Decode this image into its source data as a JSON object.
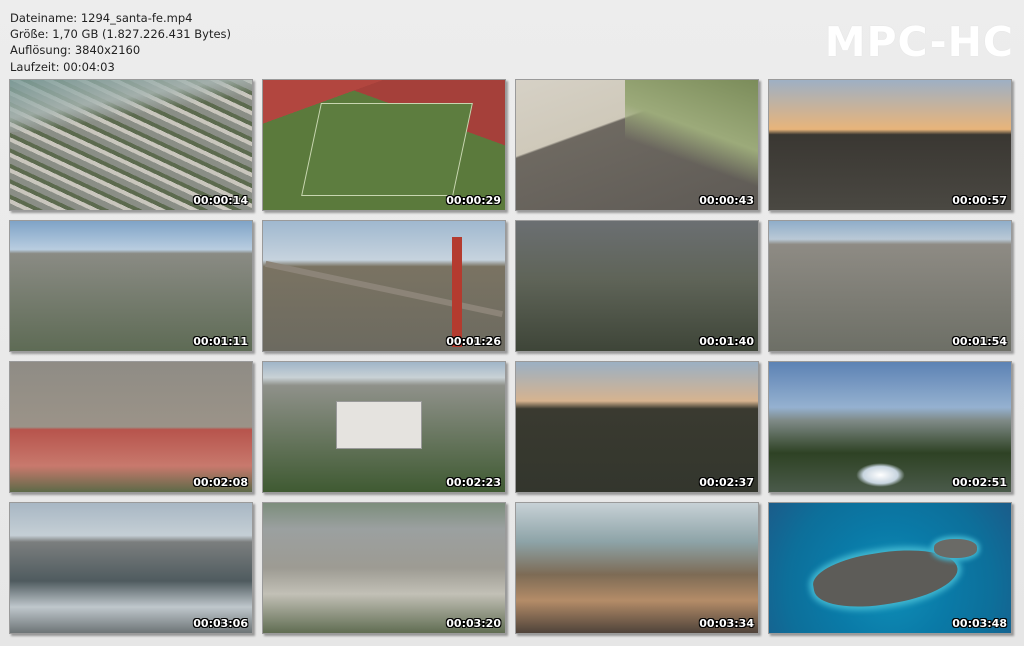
{
  "info": {
    "filename": "Dateiname: 1294_santa-fe.mp4",
    "size": "Größe: 1,70 GB (1.827.226.431 Bytes)",
    "resolution": "Auflösung: 3840x2160",
    "duration": "Laufzeit: 00:04:03"
  },
  "logo": "MPC-HC",
  "thumbnails": [
    {
      "time": "00:00:14"
    },
    {
      "time": "00:00:29"
    },
    {
      "time": "00:00:43"
    },
    {
      "time": "00:00:57"
    },
    {
      "time": "00:01:11"
    },
    {
      "time": "00:01:26"
    },
    {
      "time": "00:01:40"
    },
    {
      "time": "00:01:54"
    },
    {
      "time": "00:02:08"
    },
    {
      "time": "00:02:23"
    },
    {
      "time": "00:02:37"
    },
    {
      "time": "00:02:51"
    },
    {
      "time": "00:03:06"
    },
    {
      "time": "00:03:20"
    },
    {
      "time": "00:03:34"
    },
    {
      "time": "00:03:48"
    }
  ]
}
